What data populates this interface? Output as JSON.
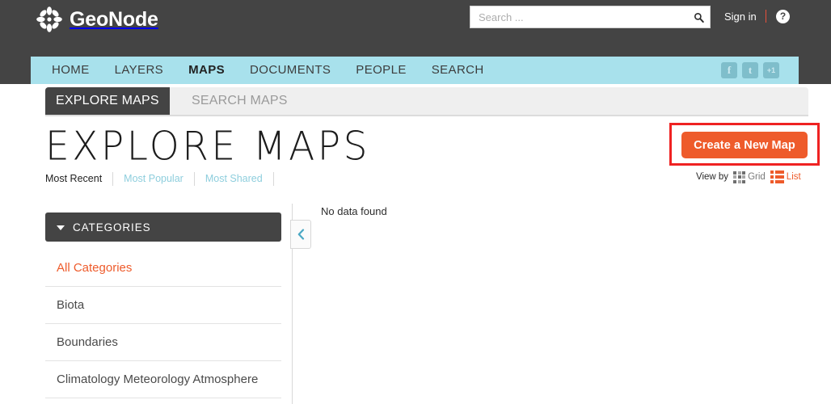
{
  "header": {
    "brand_name": "GeoNode",
    "brand_logo_icon": "geonode-flower-icon",
    "search": {
      "placeholder": "Search ...",
      "value": "",
      "button_icon": "search-icon"
    },
    "signin_label": "Sign in",
    "help_icon": "?",
    "help_icon_name": "help-circle-icon"
  },
  "nav": {
    "items": [
      {
        "label": "HOME",
        "active": false
      },
      {
        "label": "LAYERS",
        "active": false
      },
      {
        "label": "MAPS",
        "active": true
      },
      {
        "label": "DOCUMENTS",
        "active": false
      },
      {
        "label": "PEOPLE",
        "active": false
      },
      {
        "label": "SEARCH",
        "active": false
      }
    ],
    "social": [
      {
        "label": "f",
        "name": "facebook-icon"
      },
      {
        "label": "t",
        "name": "twitter-icon"
      },
      {
        "label": "+1",
        "name": "google-plusone-icon"
      }
    ]
  },
  "tabs": [
    {
      "label": "EXPLORE MAPS",
      "active": true
    },
    {
      "label": "SEARCH MAPS",
      "active": false
    }
  ],
  "page": {
    "title": "EXPLORE MAPS",
    "sort": [
      {
        "label": "Most Recent",
        "active": true
      },
      {
        "label": "Most Popular",
        "active": false
      },
      {
        "label": "Most Shared",
        "active": false
      }
    ]
  },
  "actions": {
    "create_map_label": "Create a New Map",
    "highlight_color": "#ef2222",
    "button_color": "#ee5b2b"
  },
  "view_by": {
    "label": "View by",
    "grid_label": "Grid",
    "list_label": "List",
    "active": "List"
  },
  "sidebar": {
    "header_label": "CATEGORIES",
    "items": [
      {
        "label": "All Categories",
        "active": true
      },
      {
        "label": "Biota",
        "active": false
      },
      {
        "label": "Boundaries",
        "active": false
      },
      {
        "label": "Climatology Meteorology Atmosphere",
        "active": false
      }
    ]
  },
  "main": {
    "empty_message": "No data found",
    "collapse_icon": "chevron-left-icon"
  },
  "colors": {
    "nav_teal": "#a8e1ec",
    "dark": "#444444",
    "accent_orange": "#ee5b2b",
    "link_teal": "#8ecedd"
  }
}
